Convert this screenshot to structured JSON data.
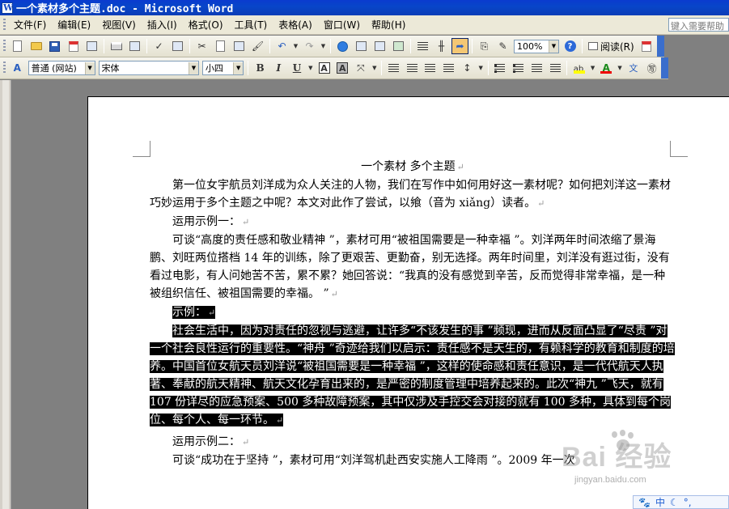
{
  "window": {
    "title": "一个素材多个主题.doc - Microsoft Word"
  },
  "menubar": {
    "items": [
      "文件(F)",
      "编辑(E)",
      "视图(V)",
      "插入(I)",
      "格式(O)",
      "工具(T)",
      "表格(A)",
      "窗口(W)",
      "帮助(H)"
    ],
    "help_placeholder": "键入需要帮助"
  },
  "standard_toolbar": {
    "zoom": "100%",
    "read_label": "阅读(R)",
    "icons": [
      "new-document-icon",
      "open-icon",
      "save-icon",
      "permission-icon",
      "email-icon",
      "print-icon",
      "print-preview-icon",
      "spelling-icon",
      "research-icon",
      "cut-icon",
      "copy-icon",
      "paste-icon",
      "format-painter-icon",
      "undo-icon",
      "redo-icon",
      "hyperlink-icon",
      "tables-borders-icon",
      "insert-table-icon",
      "insert-excel-icon",
      "columns-icon",
      "drawing-icon",
      "document-map-icon",
      "show-hide-icon",
      "ink-icon",
      "help-icon"
    ]
  },
  "format_toolbar": {
    "style": "普通 (网站)",
    "font": "宋体",
    "size": "小四",
    "bold": "B",
    "italic": "I",
    "underline": "U",
    "char_border": "A",
    "char_shading": "A",
    "highlight_color": "#ffff00",
    "font_color": "#e00000"
  },
  "document": {
    "title": "一个素材 多个主题",
    "intro": "第一位女宇航员刘洋成为众人关注的人物，我们在写作中如何用好这一素材呢？如何把刘洋这一素材巧妙运用于多个主题之中呢？本文对此作了尝试，以飨（音为 xiǎng）读者。",
    "example1_heading": "运用示例一：",
    "example1_text": "可谈“高度的责任感和敬业精神 ”，素材可用“被祖国需要是一种幸福 ”。刘洋两年时间浓缩了景海鹏、刘旺两位搭档 14 年的训练，除了更艰苦、更勤奋，别无选择。两年时间里，刘洋没有逛过街，没有看过电影，有人问她苦不苦，累不累？她回答说：“我真的没有感觉到辛苦，反而觉得非常幸福，是一种被组织信任、被祖国需要的幸福。 ”",
    "sel_heading": "示例：",
    "sel_text": "社会生活中，因为对责任的忽视与逃避，让许多“不该发生的事 ”频现，进而从反面凸显了“尽责 ”对一个社会良性运行的重要性。“神舟 ”奇迹给我们以启示：责任感不是天生的，有赖科学的教育和制度的培养。中国首位女航天员刘洋说“被祖国需要是一种幸福 ”，这样的使命感和责任意识，是一代代航天人执著、奉献的航天精神、航天文化孕育出来的，是严密的制度管理中培养起来的。此次“神九 ”飞天，就有 107 份详尽的应急预案、500 多种故障预案，其中仅涉及手控交会对接的就有 100 多种，具体到每个岗位、每个人、每一环节。",
    "example2_heading": "运用示例二：",
    "example2_text": "可谈“成功在于坚持 ”，素材可用“刘洋驾机赴西安实施人工降雨 ”。2009 年一次",
    "paragraph_mark": "↵"
  },
  "watermark": {
    "brand": "Bai  经验",
    "url": "jingyan.baidu.com"
  },
  "ime": {
    "label": "中"
  }
}
